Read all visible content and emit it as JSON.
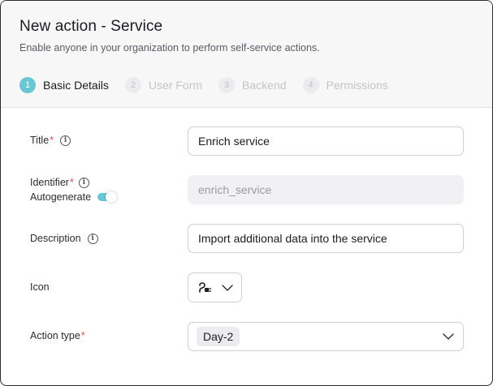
{
  "dialog": {
    "title": "New action - Service",
    "subtitle": "Enable anyone in your organization to perform self-service actions."
  },
  "steps": [
    {
      "num": "1",
      "label": "Basic Details",
      "active": true
    },
    {
      "num": "2",
      "label": "User Form",
      "active": false
    },
    {
      "num": "3",
      "label": "Backend",
      "active": false
    },
    {
      "num": "4",
      "label": "Permissions",
      "active": false
    }
  ],
  "form": {
    "title": {
      "label": "Title",
      "required": "*",
      "value": "Enrich service"
    },
    "identifier": {
      "label": "Identifier",
      "required": "*",
      "value": "enrich_service",
      "autogenerate_label": "Autogenerate",
      "autogenerate_on": true
    },
    "description": {
      "label": "Description",
      "value": "Import additional data into the service"
    },
    "icon": {
      "label": "Icon",
      "icon_name": "plug-icon"
    },
    "action_type": {
      "label": "Action type",
      "required": "*",
      "value": "Day-2"
    }
  },
  "colors": {
    "accent": "#69c6d3",
    "required": "#e5484d"
  }
}
